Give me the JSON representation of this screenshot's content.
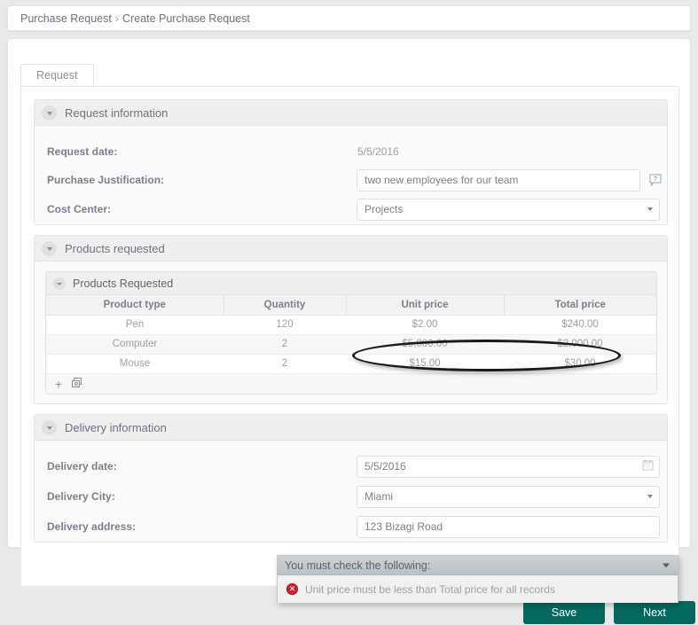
{
  "breadcrumb": {
    "root": "Purchase Request",
    "separator": "›",
    "current": "Create Purchase Request"
  },
  "tabs": [
    {
      "label": "Request",
      "active": true
    }
  ],
  "sections": {
    "request_information": {
      "title": "Request information",
      "collapse_icon": "chevron-down-icon",
      "fields": {
        "request_date": {
          "label": "Request date:",
          "value": "5/5/2016",
          "type": "readonly-text"
        },
        "purchase_justification": {
          "label": "Purchase Justification:",
          "value": "two new employees for our team",
          "type": "text",
          "help_icon": "help-balloon-icon"
        },
        "cost_center": {
          "label": "Cost Center:",
          "value": "Projects",
          "type": "dropdown",
          "caret_icon": "chevron-down-icon"
        }
      }
    },
    "products_requested": {
      "title": "Products requested",
      "collapse_icon": "chevron-down-icon",
      "grid": {
        "title": "Products Requested",
        "collapse_icon": "chevron-down-icon",
        "columns": [
          "Product type",
          "Quantity",
          "Unit price",
          "Total price"
        ],
        "rows": [
          {
            "product_type": "Pen",
            "quantity": "120",
            "unit_price": "$2.00",
            "total_price": "$240.00"
          },
          {
            "product_type": "Computer",
            "quantity": "2",
            "unit_price": "$5,000.00",
            "total_price": "$2,000.00"
          },
          {
            "product_type": "Mouse",
            "quantity": "2",
            "unit_price": "$15.00",
            "total_price": "$30.00"
          }
        ],
        "footer": {
          "add_icon": "plus-icon",
          "add_label": "+",
          "copy_icon": "copy-row-icon"
        },
        "highlight_note": "Computer row Unit price and Total price circled"
      }
    },
    "delivery_information": {
      "title": "Delivery information",
      "collapse_icon": "chevron-down-icon",
      "fields": {
        "delivery_date": {
          "label": "Delivery date:",
          "value": "5/5/2016",
          "type": "date",
          "icon": "calendar-icon"
        },
        "delivery_city": {
          "label": "Delivery City:",
          "value": "Miami",
          "type": "dropdown",
          "caret_icon": "chevron-down-icon"
        },
        "delivery_address": {
          "label": "Delivery address:",
          "value": "123 Bizagi Road",
          "type": "text"
        }
      }
    }
  },
  "validation": {
    "header": "You must check the following:",
    "caret_icon": "chevron-down-icon",
    "messages": [
      {
        "icon": "error-circle-icon",
        "text": "Unit price must be less than Total price for all records"
      }
    ]
  },
  "actions": {
    "save": "Save",
    "next": "Next"
  },
  "colors": {
    "button_green": "#046a5d",
    "error_red": "#d0232b",
    "panel_header": "#efefef",
    "page_background": "#e8e9e8",
    "text_gray": "#7b828b",
    "value_gray": "#9aa1a9"
  }
}
